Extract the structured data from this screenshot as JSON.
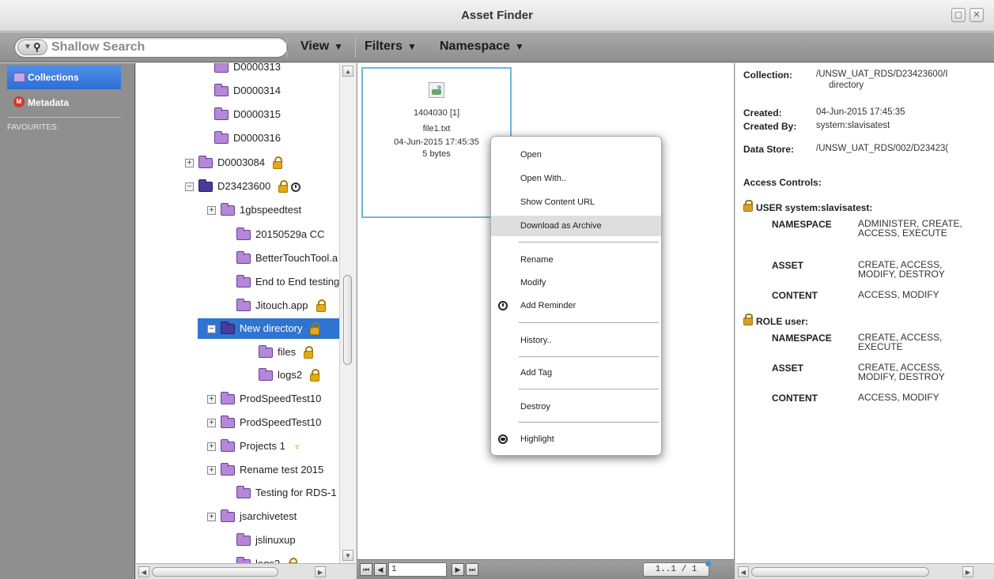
{
  "window": {
    "title": "Asset Finder",
    "restore_symbol": "▢",
    "close_symbol": "✕"
  },
  "toolbar": {
    "search_placeholder": "Shallow Search",
    "search_dropdown_arrow": "▼",
    "view_label": "View",
    "filters_label": "Filters",
    "namespace_label": "Namespace",
    "caret": "▼"
  },
  "sidebar": {
    "items": [
      {
        "label": "Collections",
        "icon": "collections-icon",
        "active": true
      },
      {
        "label": "Metadata",
        "icon": "metadata-icon",
        "badge": "M"
      }
    ],
    "favourites_label": "FAVOURITES:"
  },
  "tree": {
    "rows": [
      {
        "label": "D0000313"
      },
      {
        "label": "D0000314"
      },
      {
        "label": "D0000315"
      },
      {
        "label": "D0000316"
      },
      {
        "label": "D0003084",
        "expander": "+"
      },
      {
        "label": "D23423600",
        "expander": "−"
      },
      {
        "label": "1gbspeedtest",
        "expander": "+"
      },
      {
        "label": "20150529a CC"
      },
      {
        "label": "BetterTouchTool.a"
      },
      {
        "label": "End to End testing"
      },
      {
        "label": "Jitouch.app"
      },
      {
        "label": "New directory",
        "expander": "−",
        "selected": true
      },
      {
        "label": "files"
      },
      {
        "label": "logs2"
      },
      {
        "label": "ProdSpeedTest10",
        "expander": "+"
      },
      {
        "label": "ProdSpeedTest10",
        "expander": "+"
      },
      {
        "label": "Projects 1",
        "expander": "+"
      },
      {
        "label": "Rename test 2015",
        "expander": "+"
      },
      {
        "label": "Testing for RDS-1"
      },
      {
        "label": "jsarchivetest",
        "expander": "+"
      },
      {
        "label": "jslinuxup"
      },
      {
        "label": "logs2"
      }
    ]
  },
  "asset_tile": {
    "id_line": "1404030 [1]",
    "filename": "file1.txt",
    "date": "04-Jun-2015 17:45:35",
    "size": "5 bytes"
  },
  "context_menu": {
    "items": [
      {
        "label": "Open"
      },
      {
        "label": "Open With.."
      },
      {
        "label": "Show Content URL"
      },
      {
        "label": "Download as Archive",
        "hover": true
      },
      {
        "label": "Rename"
      },
      {
        "label": "Modify"
      },
      {
        "label": "Add Reminder",
        "icon": "clock-icon"
      },
      {
        "label": "History.."
      },
      {
        "label": "Add Tag"
      },
      {
        "label": "Destroy"
      },
      {
        "label": "Highlight",
        "icon": "highlight-icon"
      }
    ]
  },
  "pager": {
    "first": "⏮",
    "prev": "◀",
    "next": "▶",
    "last": "⏭",
    "page_value": "1",
    "page_count": "1..1 / 1"
  },
  "details": {
    "collection_label": "Collection:",
    "collection_value": "/UNSW_UAT_RDS/D23423600/I",
    "collection_value2": "directory",
    "created_label": "Created:",
    "created_value": "04-Jun-2015 17:45:35",
    "created_by_label": "Created By:",
    "created_by_value": "system:slavisatest",
    "data_store_label": "Data Store:",
    "data_store_value": "/UNSW_UAT_RDS/002/D23423(",
    "access_controls_label": "Access Controls:",
    "acl": [
      {
        "principal": "USER system:slavisatest:",
        "entries": [
          {
            "resource": "NAMESPACE",
            "permissions": "ADMINISTER, CREATE, ACCESS, EXECUTE"
          },
          {
            "resource": "ASSET",
            "permissions": "CREATE, ACCESS, MODIFY, DESTROY"
          },
          {
            "resource": "CONTENT",
            "permissions": "ACCESS, MODIFY"
          }
        ]
      },
      {
        "principal": "ROLE user:",
        "entries": [
          {
            "resource": "NAMESPACE",
            "permissions": "CREATE, ACCESS, EXECUTE"
          },
          {
            "resource": "ASSET",
            "permissions": "CREATE, ACCESS, MODIFY, DESTROY"
          },
          {
            "resource": "CONTENT",
            "permissions": "ACCESS, MODIFY"
          }
        ]
      }
    ]
  },
  "colors": {
    "selection": "#2f74d0",
    "tile_border": "#6fb6d6",
    "folder": "#b487d9",
    "lock": "#e5a912"
  }
}
